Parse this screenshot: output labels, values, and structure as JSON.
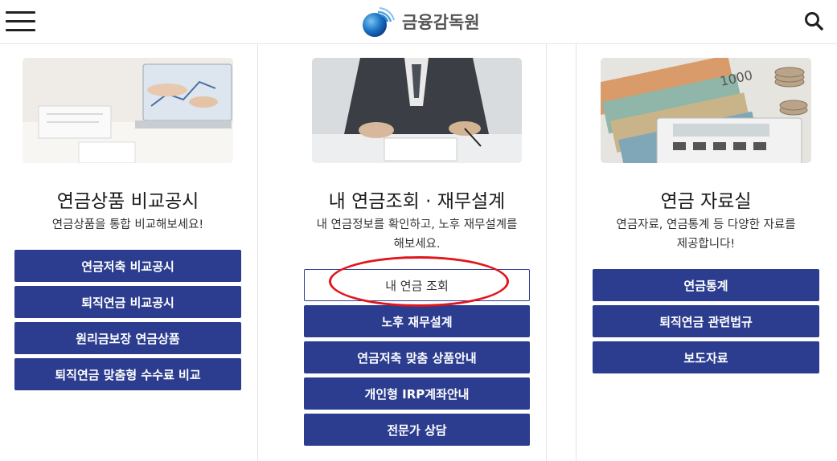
{
  "header": {
    "logo_text": "금융감독원",
    "menu_icon": "hamburger-menu-icon",
    "search_icon": "search-icon"
  },
  "columns": [
    {
      "title": "연금상품 비교공시",
      "desc": "연금상품을 통합 비교해보세요!",
      "buttons": [
        "연금저축 비교공시",
        "퇴직연금 비교공시",
        "원리금보장 연금상품",
        "퇴직연금 맞춤형 수수료 비교"
      ]
    },
    {
      "title": "내 연금조회 · 재무설계",
      "desc_line1": "내 연금정보를 확인하고, 노후 재무설계를",
      "desc_line2": "해보세요.",
      "buttons": [
        "내 연금 조회",
        "노후 재무설계",
        "연금저축 맞춤 상품안내",
        "개인형 IRP계좌안내",
        "전문가 상담"
      ]
    },
    {
      "title": "연금 자료실",
      "desc_line1": "연금자료, 연금통계 등 다양한 자료를",
      "desc_line2": "제공합니다!",
      "buttons": [
        "연금통계",
        "퇴직연금 관련법규",
        "보도자료"
      ]
    }
  ],
  "colors": {
    "button_bg": "#2c3d8f",
    "highlight_oval": "#e0161c"
  }
}
